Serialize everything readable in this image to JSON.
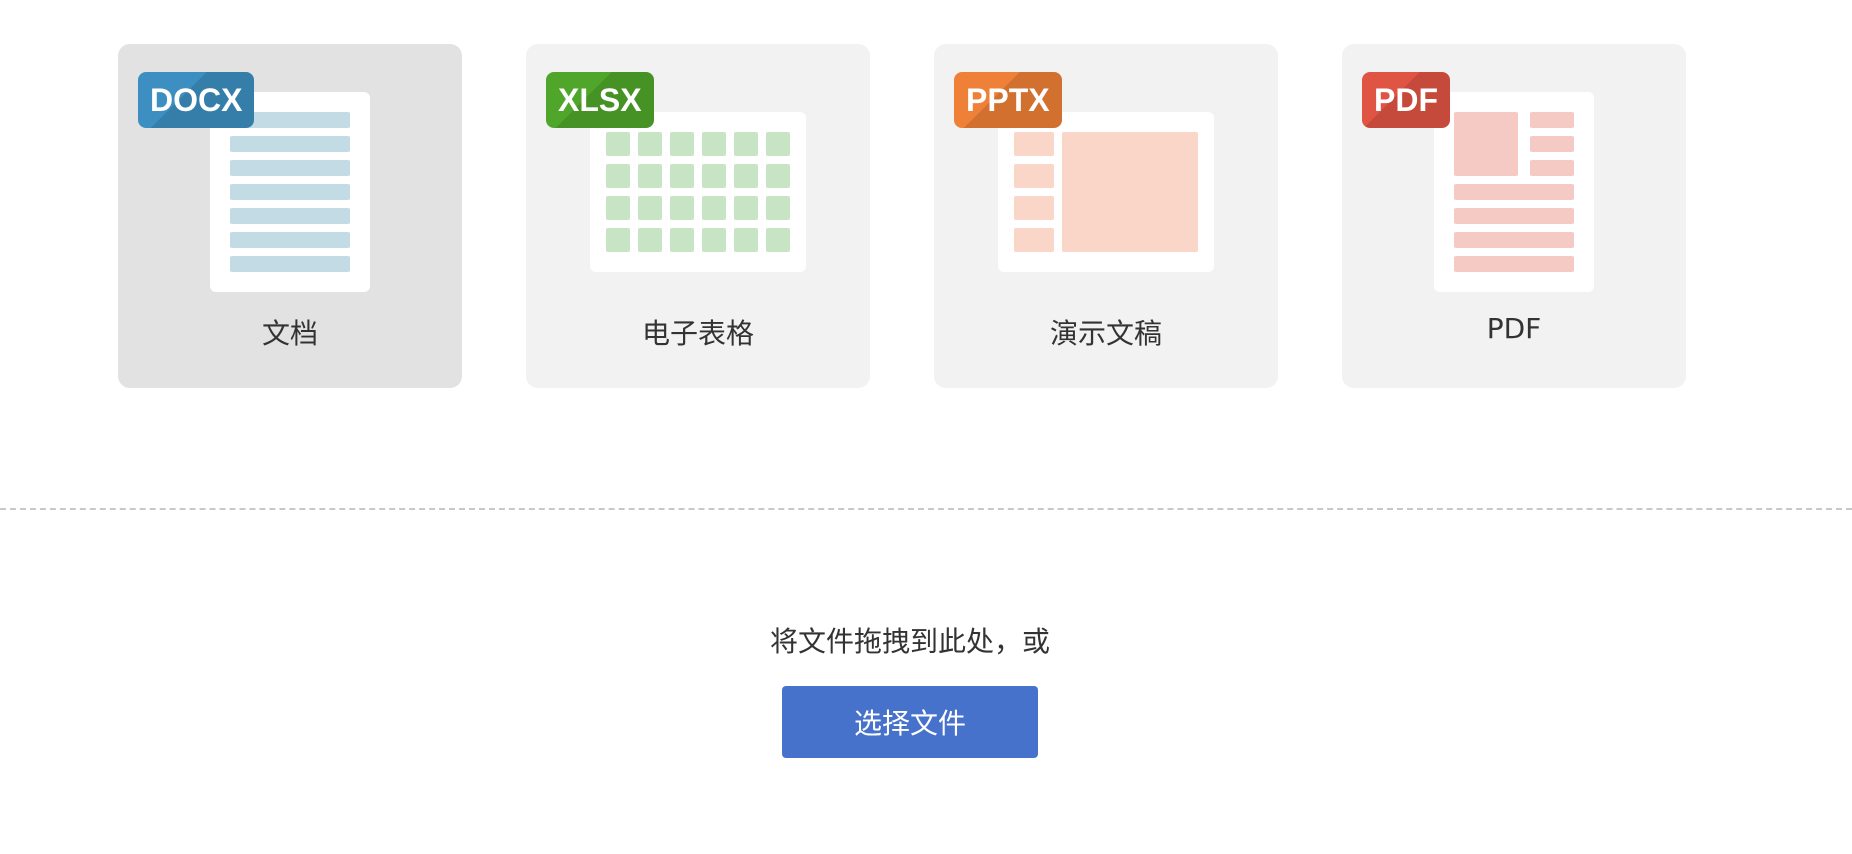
{
  "file_types": [
    {
      "badge": "DOCX",
      "label": "文档",
      "icon": "docx-file-icon",
      "badge_color": "#3d8fc1",
      "accent_color": "#c2dbe5",
      "active": true
    },
    {
      "badge": "XLSX",
      "label": "电子表格",
      "icon": "xlsx-file-icon",
      "badge_color": "#4fa62a",
      "accent_color": "#c7e4c5",
      "active": false
    },
    {
      "badge": "PPTX",
      "label": "演示文稿",
      "icon": "pptx-file-icon",
      "badge_color": "#ef8037",
      "accent_color": "#f9d6c7",
      "active": false
    },
    {
      "badge": "PDF",
      "label": "PDF",
      "icon": "pdf-file-icon",
      "badge_color": "#e05443",
      "accent_color": "#f5c9c4",
      "active": false
    }
  ],
  "upload": {
    "drop_hint": "将文件拖拽到此处，或",
    "select_button": "选择文件",
    "button_color": "#4672cb"
  }
}
